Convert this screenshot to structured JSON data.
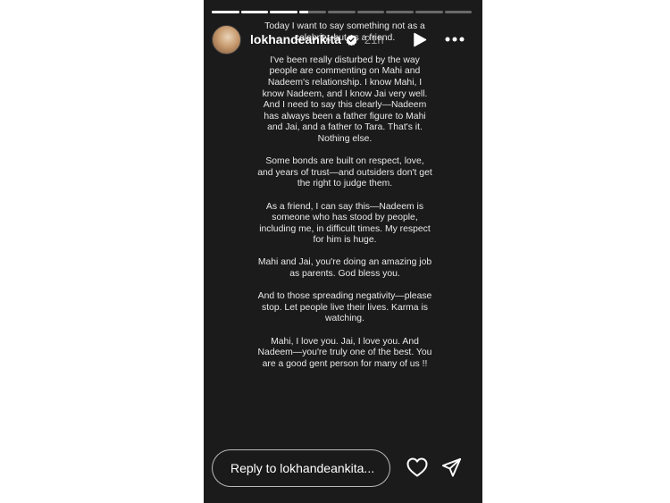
{
  "story": {
    "progress": [
      1,
      1,
      1,
      0.35,
      0,
      0,
      0,
      0,
      0
    ],
    "user": {
      "username": "lokhandeankita",
      "time": "21h"
    },
    "paragraphs": [
      "Today I want to say something not as a celebrity, but as a friend.",
      "I've been really disturbed by the way people are commenting on Mahi and Nadeem's relationship. I know Mahi, I know Nadeem, and I know Jai very well. And I need to say this clearly—Nadeem has always been a father figure to Mahi and Jai, and a father to Tara. That's it. Nothing else.",
      "Some bonds are built on respect, love, and years of trust—and outsiders don't get the right to judge them.",
      "As a friend, I can say this—Nadeem is someone who has stood by people, including me, in difficult times. My respect for him is huge.",
      "Mahi and Jai, you're doing an amazing job as parents. God bless you.",
      "And to those spreading negativity—please stop. Let people live their lives. Karma is watching.",
      "Mahi, I love you. Jai, I love you. And Nadeem—you're truly one of the best. You are a good gent person for many of us !!"
    ],
    "reply_placeholder": "Reply to lokhandeankita..."
  }
}
